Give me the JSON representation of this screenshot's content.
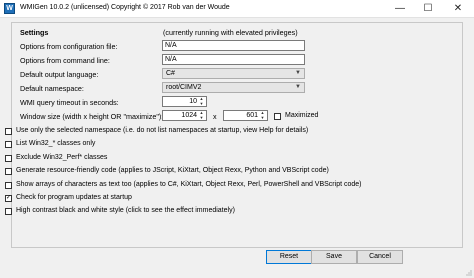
{
  "window": {
    "title": "WMIGen  10.0.2  (unlicensed)  Copyright © 2017 Rob van der Woude",
    "icon_text": "W",
    "minimize_glyph": "—",
    "maximize_glyph": "☐",
    "close_glyph": "✕"
  },
  "settings": {
    "heading": "Settings",
    "status": "(currently running with elevated privileges)",
    "options_config_label": "Options from configuration file:",
    "options_config_value": "N/A",
    "options_cmdline_label": "Options from command line:",
    "options_cmdline_value": "N/A",
    "output_language_label": "Default output language:",
    "output_language_value": "C#",
    "namespace_label": "Default namespace:",
    "namespace_value": "root/CIMV2",
    "timeout_label": "WMI query timeout in seconds:",
    "timeout_value": "10",
    "window_size_label": "Window size (width x height OR \"maximize\"):",
    "window_width": "1024",
    "window_x": "x",
    "window_height": "601",
    "maximized_label": "Maximized"
  },
  "checkboxes": [
    {
      "label": "Use only the selected namespace (i.e. do not list namespaces at startup, view Help for details)",
      "checked": false
    },
    {
      "label": "List Win32_* classes only",
      "checked": false
    },
    {
      "label": "Exclude Win32_Perf* classes",
      "checked": false
    },
    {
      "label": "Generate resource-friendly code (applies to JScript, KiXtart, Object Rexx, Python and VBScript code)",
      "checked": false
    },
    {
      "label": "Show arrays of characters as text too (applies to C#, KiXtart, Object Rexx, Perl, PowerShell and VBScript code)",
      "checked": false
    },
    {
      "label": "Check for program updates at startup",
      "checked": true
    },
    {
      "label": "High contrast black and white style (click to see the effect immediately)",
      "checked": false
    }
  ],
  "buttons": {
    "reset": "Reset",
    "save": "Save",
    "cancel": "Cancel"
  },
  "colors": {
    "accent": "#0078d7",
    "window_bg": "#f0f0f0"
  }
}
